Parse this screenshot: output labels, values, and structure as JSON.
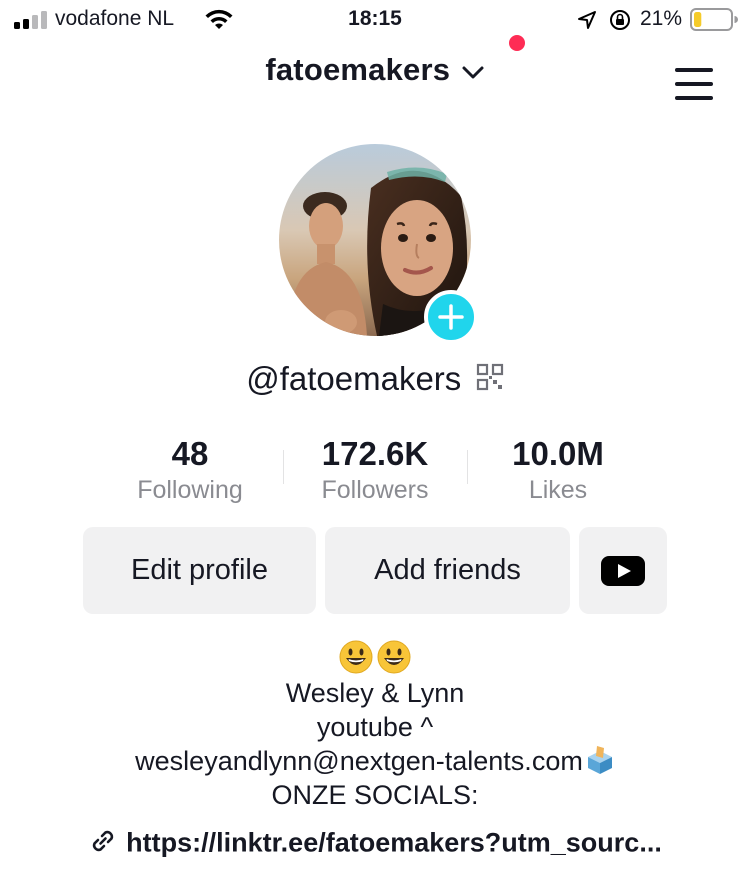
{
  "status_bar": {
    "carrier": "vodafone NL",
    "time": "18:15",
    "battery_percent": "21%",
    "battery_level": 0.21
  },
  "header": {
    "username": "fatoemakers",
    "notification_dot_color": "#fe2c55"
  },
  "profile": {
    "handle": "@fatoemakers",
    "add_button_color": "#20d5ec"
  },
  "stats": [
    {
      "value": "48",
      "label": "Following"
    },
    {
      "value": "172.6K",
      "label": "Followers"
    },
    {
      "value": "10.0M",
      "label": "Likes"
    }
  ],
  "actions": {
    "edit_profile": "Edit profile",
    "add_friends": "Add friends",
    "youtube_icon": "youtube-icon"
  },
  "bio": {
    "emojis": "😃😃",
    "line1": "Wesley & Lynn",
    "line2": "youtube ^",
    "line3": "wesleyandlynn@nextgen-talents.com",
    "line3_emoji": "🗳",
    "line4": "ONZE SOCIALS:"
  },
  "link": {
    "url": "https://linktr.ee/fatoemakers?utm_sourc...",
    "icon": "link-icon"
  }
}
